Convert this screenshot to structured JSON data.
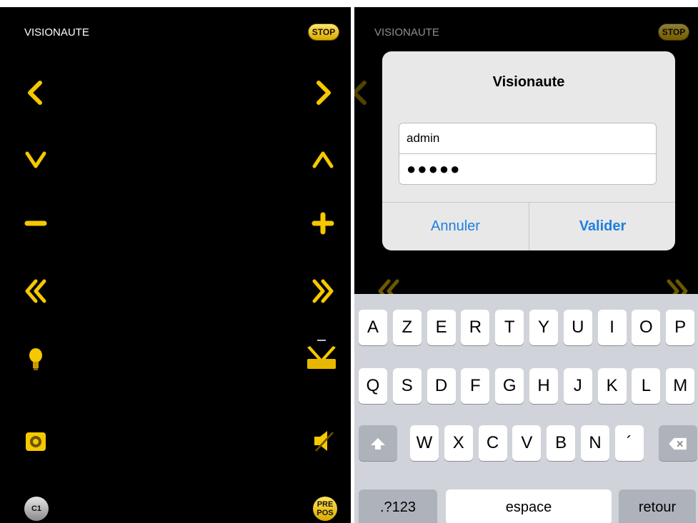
{
  "app": {
    "title": "VISIONAUTE",
    "stop_label": "STOP"
  },
  "left_controls": {
    "c1_label": "C1",
    "prepos_label_1": "PRE",
    "prepos_label_2": "POS"
  },
  "colors": {
    "accent_yellow": "#f5c800",
    "ios_blue": "#1f7fe0",
    "keyboard_bg": "#d0d3d9"
  },
  "dialog": {
    "title": "Visionaute",
    "username_value": "admin",
    "password_value": "●●●●●",
    "cancel_label": "Annuler",
    "ok_label": "Valider"
  },
  "keyboard": {
    "row1": [
      "A",
      "Z",
      "E",
      "R",
      "T",
      "Y",
      "U",
      "I",
      "O",
      "P"
    ],
    "row2": [
      "Q",
      "S",
      "D",
      "F",
      "G",
      "H",
      "J",
      "K",
      "L",
      "M"
    ],
    "row3": [
      "W",
      "X",
      "C",
      "V",
      "B",
      "N",
      "´"
    ],
    "numbers_label": ".?123",
    "space_label": "espace",
    "return_label": "retour"
  },
  "icons": [
    "chevron-left-icon",
    "chevron-right-icon",
    "chevron-down-icon",
    "chevron-up-icon",
    "minus-icon",
    "plus-icon",
    "rewind-icon",
    "fast-forward-icon",
    "lightbulb-icon",
    "wiper-icon",
    "camera-icon",
    "speaker-icon",
    "shift-icon",
    "backspace-icon"
  ]
}
